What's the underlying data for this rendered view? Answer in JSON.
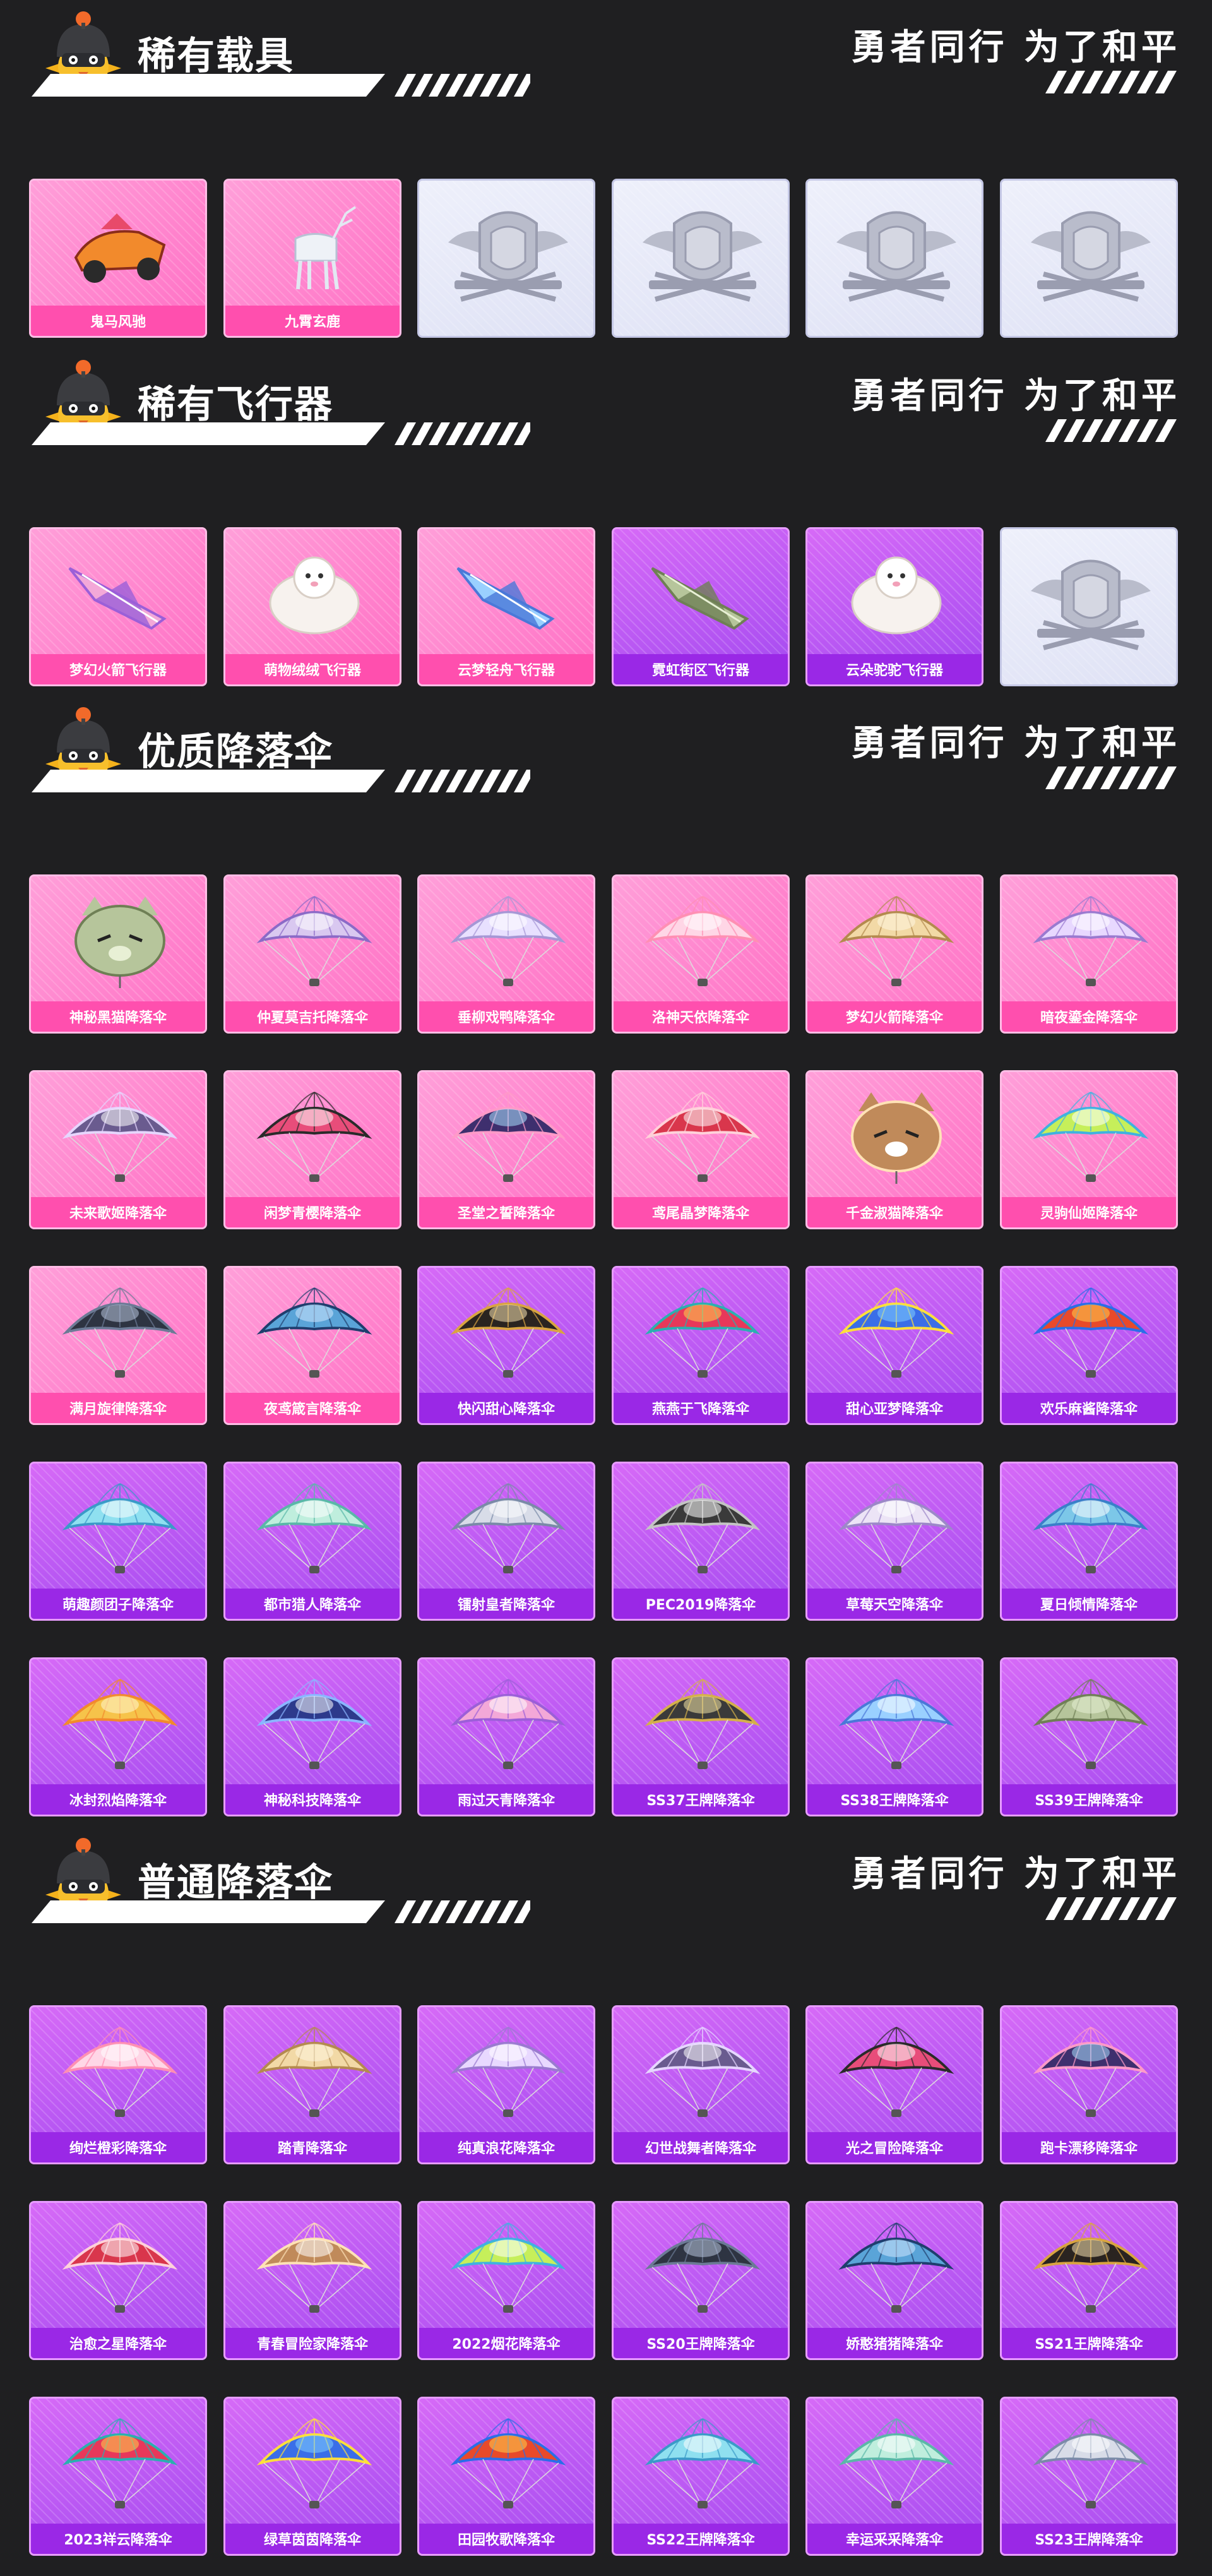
{
  "slogan": "勇者同行 为了和平",
  "sections": [
    {
      "title": "稀有载具",
      "cards": [
        {
          "label": "鬼马风驰",
          "color": "pink",
          "icon": "vehicle-icon"
        },
        {
          "label": "九霄玄鹿",
          "color": "pink",
          "icon": "deer-vehicle-icon"
        },
        {
          "label": "",
          "color": "empty",
          "icon": "pubg-emblem-icon"
        },
        {
          "label": "",
          "color": "empty",
          "icon": "pubg-emblem-icon"
        },
        {
          "label": "",
          "color": "empty",
          "icon": "pubg-emblem-icon"
        },
        {
          "label": "",
          "color": "empty",
          "icon": "pubg-emblem-icon"
        }
      ]
    },
    {
      "title": "稀有飞行器",
      "cards": [
        {
          "label": "梦幻火箭飞行器",
          "color": "pink",
          "icon": "glider-icon"
        },
        {
          "label": "萌物绒绒飞行器",
          "color": "pink",
          "icon": "plush-glider-icon"
        },
        {
          "label": "云梦轻舟飞行器",
          "color": "pink",
          "icon": "boat-glider-icon"
        },
        {
          "label": "霓虹街区飞行器",
          "color": "purple",
          "icon": "paper-plane-icon"
        },
        {
          "label": "云朵驼驼飞行器",
          "color": "purple",
          "icon": "alpaca-glider-icon"
        },
        {
          "label": "",
          "color": "empty",
          "icon": "pubg-emblem-icon"
        }
      ]
    },
    {
      "title": "优质降落伞",
      "cards": [
        {
          "label": "神秘黑猫降落伞",
          "color": "pink",
          "icon": "cat-parachute-icon"
        },
        {
          "label": "仲夏莫吉托降落伞",
          "color": "pink",
          "icon": "parachute-icon"
        },
        {
          "label": "垂柳戏鸭降落伞",
          "color": "pink",
          "icon": "parachute-icon"
        },
        {
          "label": "洛神天依降落伞",
          "color": "pink",
          "icon": "parachute-icon"
        },
        {
          "label": "梦幻火箭降落伞",
          "color": "pink",
          "icon": "parachute-icon"
        },
        {
          "label": "暗夜鎏金降落伞",
          "color": "pink",
          "icon": "parachute-icon"
        },
        {
          "label": "未来歌姬降落伞",
          "color": "pink",
          "icon": "parachute-icon"
        },
        {
          "label": "闲梦青樱降落伞",
          "color": "pink",
          "icon": "parachute-icon"
        },
        {
          "label": "圣堂之誓降落伞",
          "color": "pink",
          "icon": "parachute-icon"
        },
        {
          "label": "鸢尾晶梦降落伞",
          "color": "pink",
          "icon": "parachute-icon"
        },
        {
          "label": "千金淑猫降落伞",
          "color": "pink",
          "icon": "cat-parachute-icon"
        },
        {
          "label": "灵驹仙姬降落伞",
          "color": "pink",
          "icon": "parachute-icon"
        },
        {
          "label": "满月旋律降落伞",
          "color": "pink",
          "icon": "parachute-icon"
        },
        {
          "label": "夜鸢箴言降落伞",
          "color": "pink",
          "icon": "parachute-icon"
        },
        {
          "label": "快闪甜心降落伞",
          "color": "purple",
          "icon": "parachute-icon"
        },
        {
          "label": "燕燕于飞降落伞",
          "color": "purple",
          "icon": "parachute-icon"
        },
        {
          "label": "甜心亚梦降落伞",
          "color": "purple",
          "icon": "parachute-icon"
        },
        {
          "label": "欢乐麻酱降落伞",
          "color": "purple",
          "icon": "parachute-icon"
        },
        {
          "label": "萌趣颜团子降落伞",
          "color": "purple",
          "icon": "parachute-icon"
        },
        {
          "label": "都市猎人降落伞",
          "color": "purple",
          "icon": "parachute-icon"
        },
        {
          "label": "镭射皇者降落伞",
          "color": "purple",
          "icon": "parachute-icon"
        },
        {
          "label": "PEC2019降落伞",
          "color": "purple",
          "icon": "parachute-icon"
        },
        {
          "label": "草莓天空降落伞",
          "color": "purple",
          "icon": "parachute-icon"
        },
        {
          "label": "夏日倾情降落伞",
          "color": "purple",
          "icon": "parachute-icon"
        },
        {
          "label": "冰封烈焰降落伞",
          "color": "purple",
          "icon": "parachute-icon"
        },
        {
          "label": "神秘科技降落伞",
          "color": "purple",
          "icon": "parachute-icon"
        },
        {
          "label": "雨过天青降落伞",
          "color": "purple",
          "icon": "parachute-icon"
        },
        {
          "label": "SS37王牌降落伞",
          "color": "purple",
          "icon": "parachute-icon"
        },
        {
          "label": "SS38王牌降落伞",
          "color": "purple",
          "icon": "parachute-icon"
        },
        {
          "label": "SS39王牌降落伞",
          "color": "purple",
          "icon": "parachute-icon"
        }
      ]
    },
    {
      "title": "普通降落伞",
      "cards": [
        {
          "label": "绚烂橙彩降落伞",
          "color": "purple",
          "icon": "parachute-icon"
        },
        {
          "label": "踏青降落伞",
          "color": "purple",
          "icon": "parachute-icon"
        },
        {
          "label": "纯真浪花降落伞",
          "color": "purple",
          "icon": "parachute-icon"
        },
        {
          "label": "幻世战舞者降落伞",
          "color": "purple",
          "icon": "parachute-icon"
        },
        {
          "label": "光之冒险降落伞",
          "color": "purple",
          "icon": "parachute-icon"
        },
        {
          "label": "跑卡漂移降落伞",
          "color": "purple",
          "icon": "parachute-icon"
        },
        {
          "label": "治愈之星降落伞",
          "color": "purple",
          "icon": "parachute-icon"
        },
        {
          "label": "青春冒险家降落伞",
          "color": "purple",
          "icon": "parachute-icon"
        },
        {
          "label": "2022烟花降落伞",
          "color": "purple",
          "icon": "parachute-icon"
        },
        {
          "label": "SS20王牌降落伞",
          "color": "purple",
          "icon": "parachute-icon"
        },
        {
          "label": "娇憨猪猪降落伞",
          "color": "purple",
          "icon": "parachute-icon"
        },
        {
          "label": "SS21王牌降落伞",
          "color": "purple",
          "icon": "parachute-icon"
        },
        {
          "label": "2023祥云降落伞",
          "color": "purple",
          "icon": "parachute-icon"
        },
        {
          "label": "绿草茵茵降落伞",
          "color": "purple",
          "icon": "parachute-icon"
        },
        {
          "label": "田园牧歌降落伞",
          "color": "purple",
          "icon": "parachute-icon"
        },
        {
          "label": "SS22王牌降落伞",
          "color": "purple",
          "icon": "parachute-icon"
        },
        {
          "label": "幸运采采降落伞",
          "color": "purple",
          "icon": "parachute-icon"
        },
        {
          "label": "SS23王牌降落伞",
          "color": "purple",
          "icon": "parachute-icon"
        }
      ]
    }
  ]
}
